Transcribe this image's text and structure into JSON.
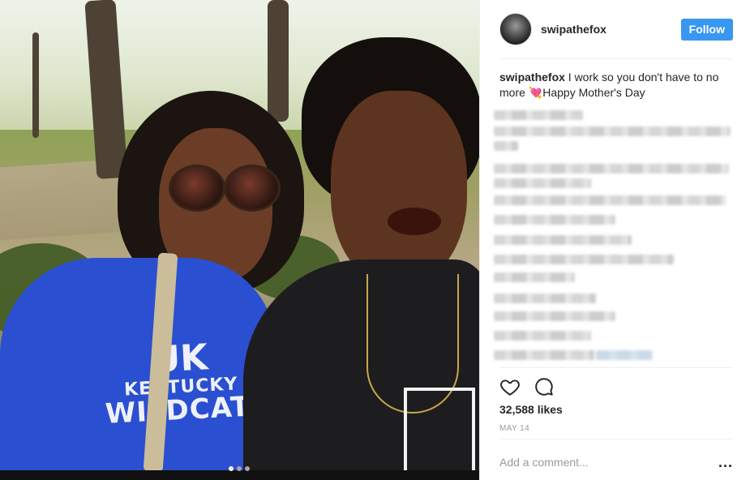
{
  "post": {
    "username": "swipathefox",
    "follow_label": "Follow",
    "caption": {
      "user": "swipathefox",
      "text_before": " I work so you don't have to no more ",
      "emoji": "💘",
      "text_after": "Happy Mother's Day"
    },
    "likes": "32,588 likes",
    "date": "MAY 14",
    "comment_placeholder": "Add a comment...",
    "more_label": "...",
    "carousel": {
      "count": 3,
      "active_index": 0
    },
    "colors": {
      "accent": "#3897f0",
      "muted": "#999999",
      "text": "#262626"
    }
  },
  "photo": {
    "shirt_text": {
      "logo": "UK",
      "line1": "KENTUCKY",
      "line2": "WILDCATS"
    }
  },
  "icons": {
    "like": "heart-outline-icon",
    "comment": "speech-bubble-icon",
    "more": "ellipsis-icon"
  }
}
